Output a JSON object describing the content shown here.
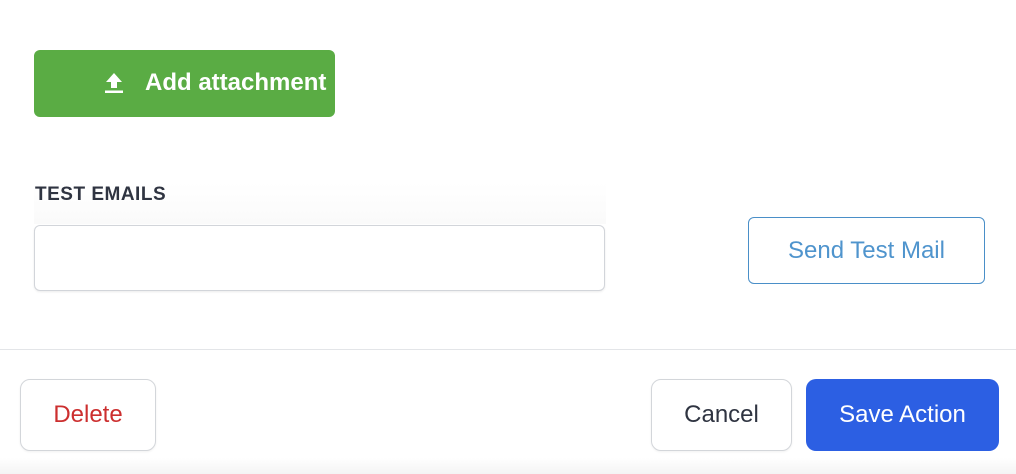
{
  "attachment": {
    "label": "Add attachment",
    "icon": "upload-icon",
    "color": "#5aac44"
  },
  "test_emails": {
    "label": "TEST EMAILS",
    "value": "",
    "placeholder": ""
  },
  "send_test": {
    "label": "Send Test Mail",
    "color": "#4f94cd"
  },
  "footer": {
    "delete_label": "Delete",
    "cancel_label": "Cancel",
    "save_label": "Save Action",
    "delete_color": "#cc2f2f",
    "save_color": "#2c5fe3"
  }
}
